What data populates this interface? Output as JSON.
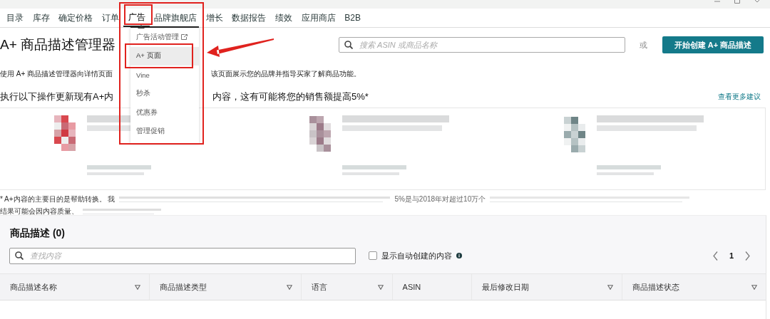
{
  "nav": {
    "items": [
      {
        "label": "目录",
        "selected": false
      },
      {
        "label": "库存",
        "selected": false
      },
      {
        "label": "确定价格",
        "selected": false
      },
      {
        "label": "订单",
        "selected": false
      },
      {
        "label": "广告",
        "selected": true
      },
      {
        "label": "品牌旗舰店",
        "selected": false
      },
      {
        "label": "增长",
        "selected": false
      },
      {
        "label": "数据报告",
        "selected": false
      },
      {
        "label": "绩效",
        "selected": false
      },
      {
        "label": "应用商店",
        "selected": false
      },
      {
        "label": "B2B",
        "selected": false
      }
    ]
  },
  "dropdown": {
    "items": [
      {
        "label": "广告活动管理",
        "external": true,
        "selected": false
      },
      {
        "label": "A+ 页面",
        "external": false,
        "selected": true
      },
      {
        "label": "Vine",
        "external": false,
        "selected": false
      },
      {
        "label": "秒杀",
        "external": false,
        "selected": false
      },
      {
        "label": "优惠券",
        "external": false,
        "selected": false
      },
      {
        "label": "管理促销",
        "external": false,
        "selected": false
      }
    ]
  },
  "header": {
    "title": "A+ 商品描述管理器",
    "search_placeholder": "搜索 ASIN 或商品名称",
    "or_label": "或",
    "create_button": "开始创建 A+ 商品描述"
  },
  "intro": {
    "text_before_menu": "使用 A+ 商品描述管理器向详情页面",
    "text_after_menu": "该页面展示您的品牌并指导买家了解商品功能。"
  },
  "suggestions": {
    "heading_before_menu": "执行以下操作更新现有A+内",
    "heading_after_menu": "内容，这有可能将您的销售额提高5%*",
    "more_link": "查看更多建议"
  },
  "footnote": {
    "line_1_start": "* A+内容的主要目的是帮助转换。 我",
    "line_1_end": "5%是与2018年对超过10万个",
    "line_2_start": "结果可能会因内容质量、"
  },
  "content": {
    "title": "商品描述 (0)",
    "search_placeholder": "查找内容",
    "auto_created": {
      "label": "显示自动创建的内容",
      "checked": false
    },
    "page": "1",
    "columns": [
      {
        "label": "商品描述名称",
        "sortable": true
      },
      {
        "label": "商品描述类型",
        "sortable": true
      },
      {
        "label": "语言",
        "sortable": true
      },
      {
        "label": "ASIN",
        "sortable": false
      },
      {
        "label": "最后修改日期",
        "sortable": true
      },
      {
        "label": "商品描述状态",
        "sortable": true
      }
    ]
  }
}
